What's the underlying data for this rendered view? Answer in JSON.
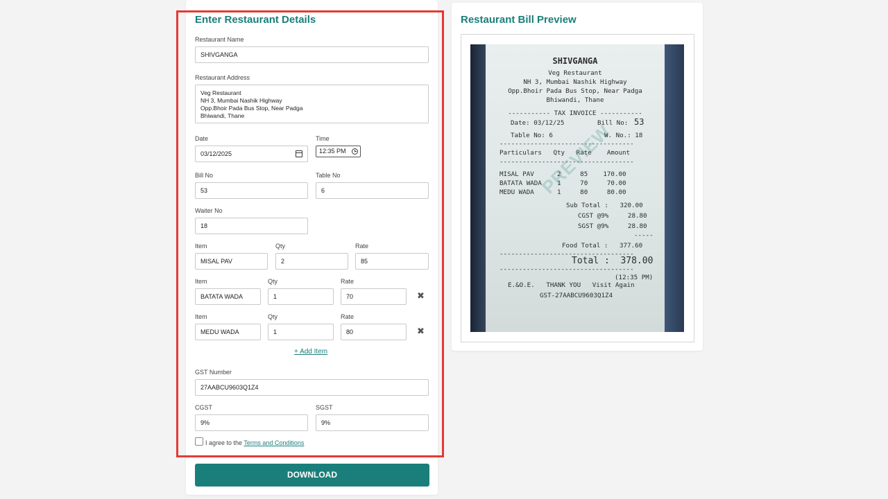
{
  "form": {
    "title": "Enter Restaurant Details",
    "restaurant_name_label": "Restaurant Name",
    "restaurant_name": "SHIVGANGA",
    "restaurant_address_label": "Restaurant Address",
    "restaurant_address_lines": [
      "Veg Restaurant",
      "NH 3, Mumbai Nashik Highway",
      "Opp.Bhoir Pada Bus Stop, Near Padga",
      "Bhiwandi, Thane"
    ],
    "date_label": "Date",
    "date": "03/12/2025",
    "time_label": "Time",
    "time": "12:35 PM",
    "bill_no_label": "Bill No",
    "bill_no": "53",
    "table_no_label": "Table No",
    "table_no": "6",
    "waiter_no_label": "Waiter No",
    "waiter_no": "18",
    "item_label": "Item",
    "qty_label": "Qty",
    "rate_label": "Rate",
    "items": [
      {
        "item": "MISAL PAV",
        "qty": "2",
        "rate": "85"
      },
      {
        "item": "BATATA WADA",
        "qty": "1",
        "rate": "70"
      },
      {
        "item": "MEDU WADA",
        "qty": "1",
        "rate": "80"
      }
    ],
    "remove_symbol": "✖",
    "add_item": "+ Add Item",
    "gst_number_label": "GST Number",
    "gst_number": "27AABCU9603Q1Z4",
    "cgst_label": "CGST",
    "cgst": "9%",
    "sgst_label": "SGST",
    "sgst": "9%",
    "agree_prefix": "I agree to the ",
    "terms_link": "Terms and Conditions",
    "download": "DOWNLOAD"
  },
  "preview": {
    "title": "Restaurant Bill Preview",
    "watermark": "PREVIEW",
    "receipt": {
      "name": "SHIVGANGA",
      "lines": [
        "Veg Restaurant",
        "NH 3, Mumbai Nashik Highway",
        "Opp.Bhoir Pada Bus Stop, Near Padga",
        "Bhiwandi, Thane"
      ],
      "invoice_header": "----------- TAX INVOICE -----------",
      "date_line": "Date: 03/12/25",
      "bill_no_label": "Bill No:",
      "bill_no": "53",
      "table_line": "Table No: 6",
      "waiter_line": "W. No.: 18",
      "separator": "-----------------------------------",
      "col_header": "Particulars   Qty   Rate    Amount",
      "rows": [
        "MISAL PAV      2     85    170.00",
        "BATATA WADA    1     70     70.00",
        "MEDU WADA      1     80     80.00"
      ],
      "sub_total": "Sub Total :   320.00",
      "cgst": "CGST @9%     28.80",
      "sgst": "SGST @9%     28.80",
      "dash_short": "-----",
      "food_total": "Food Total :   377.60",
      "total": "Total :  378.00",
      "time": "(12:35 PM)",
      "footer": "E.&O.E.   THANK YOU   Visit Again",
      "gst": "GST-27AABCU9603Q1Z4"
    }
  },
  "colors": {
    "accent": "#1a7f7a",
    "highlight": "#e53935"
  }
}
